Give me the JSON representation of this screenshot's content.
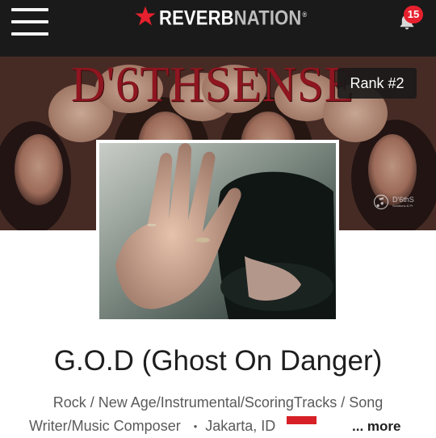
{
  "header": {
    "brand_part1": "REVERB",
    "brand_part2": "NATION",
    "brand_mark": "®",
    "notification_count": "15",
    "icons": [
      "menu-icon",
      "star-icon",
      "bell-icon"
    ],
    "colors": {
      "bar": "#1a1a1a",
      "brand_star": "#e6202e",
      "badge": "#e6202e"
    }
  },
  "banner": {
    "title_art": "D'6THSENSE",
    "rank_label": "Rank #2",
    "watermark_text": "D'6thS",
    "watermark_small": "Solutions & Pr"
  },
  "profile": {
    "artist_name": "G.O.D (Ghost On Danger)",
    "genres_line1": "Rock / New Age/Instrumental/ScoringTracks / Song",
    "genres_line2": "Writer/Music Composer",
    "separator": "•",
    "location": "Jakarta, ID",
    "flag": "indonesia-flag-icon",
    "more_label": "... more"
  }
}
